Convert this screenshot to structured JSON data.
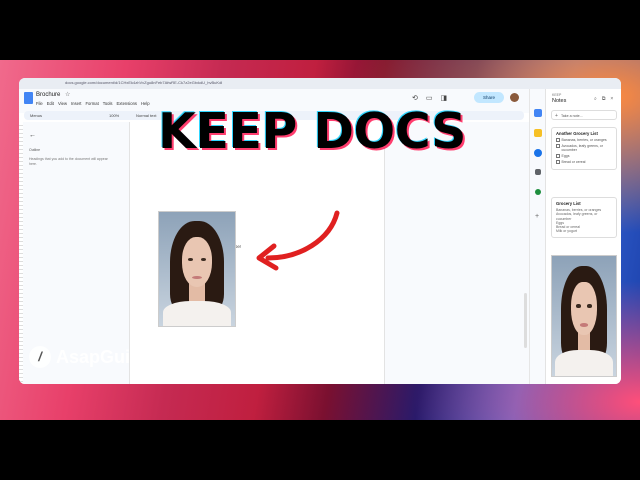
{
  "browser": {
    "url": "docs.google.com/document/d/1CHxEk4zhVvZgu8nFeb7AfwRE-Ck7z2eGtxkdU_hvBuKdI"
  },
  "doc": {
    "title": "Brochure",
    "menus": [
      "File",
      "Edit",
      "View",
      "Insert",
      "Format",
      "Tools",
      "Extensions",
      "Help"
    ],
    "share_label": "Share",
    "toolbar": {
      "search": "Menus",
      "zoom": "100%",
      "style": "Normal text"
    }
  },
  "outline": {
    "title": "Outline",
    "hint": "Headings that you add to the document will appear here."
  },
  "checklist": [
    "Bananas, berries, or oranges",
    "Avocados, leafy greens, or cucumber",
    "Eggs",
    "Bread or cereal",
    "Milk or yogurt"
  ],
  "keep": {
    "app_label": "KEEP",
    "title": "Notes",
    "take_note": "Take a note...",
    "note1": {
      "title": "Another Grocery List",
      "items": [
        "Bananas, berries, or oranges",
        "Avocados, leafy greens, or cucumber",
        "Eggs",
        "Bread or cereal"
      ]
    },
    "note2": {
      "title": "Grocery List",
      "text": "Bananas, berries, or oranges\nAvocados, leafy greens, or cucumber\nEggs\nBread or cereal\nMilk or yogurt"
    }
  },
  "overlay": {
    "headline": "KEEP DOCS",
    "brand": "AsapGuide",
    "arrow_color": "#e02020"
  },
  "colors": {
    "accent": "#4285f4",
    "share_bg": "#c2e7ff"
  }
}
